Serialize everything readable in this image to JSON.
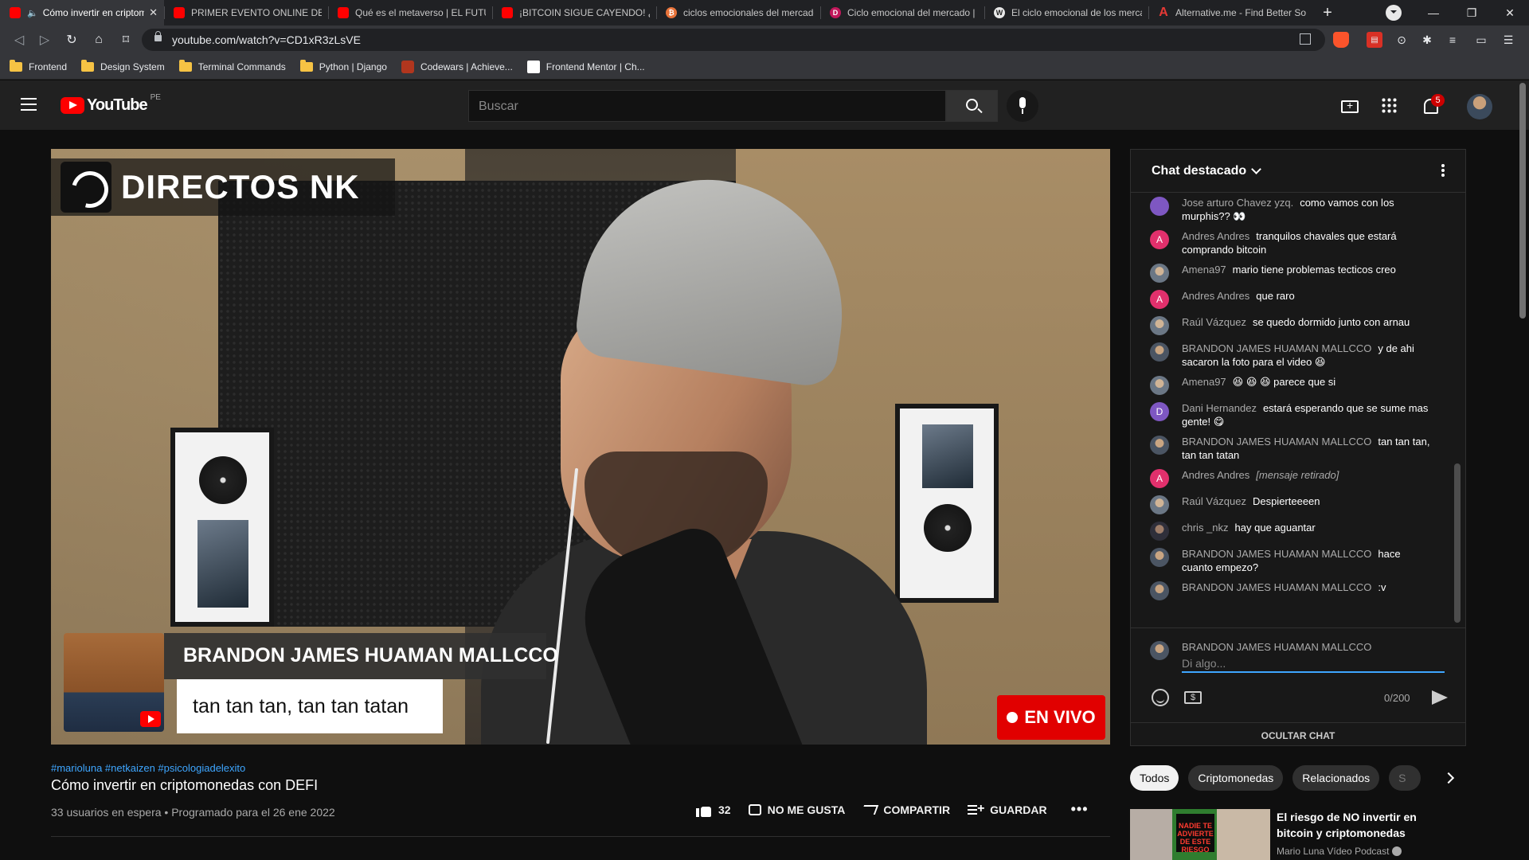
{
  "browser": {
    "tabs": [
      {
        "favicon": "youtube-favicon",
        "label": "Cómo invertir en criptomo",
        "active": true,
        "audio": true
      },
      {
        "favicon": "youtube-favicon",
        "label": "PRIMER EVENTO ONLINE DE COI",
        "active": false
      },
      {
        "favicon": "youtube-favicon",
        "label": "Qué es el metaverso | EL FUTURO",
        "active": false
      },
      {
        "favicon": "youtube-favicon",
        "label": "¡BITCOIN SIGUE CAYENDO! ¿Qué",
        "active": false
      },
      {
        "favicon": "bitcoin-favicon",
        "label": "ciclos emocionales del mercado",
        "active": false
      },
      {
        "favicon": "dp-favicon",
        "label": "Ciclo emocional del mercado | D",
        "active": false
      },
      {
        "favicon": "wikipedia-favicon",
        "label": "El ciclo emocional de los mercad",
        "active": false
      },
      {
        "favicon": "alternativeto-favicon",
        "label": "Alternative.me - Find Better Soft",
        "active": false
      }
    ],
    "url": "youtube.com/watch?v=CD1xR3zLsVE",
    "bookmarks": [
      {
        "type": "folder",
        "label": "Frontend"
      },
      {
        "type": "folder",
        "label": "Design System"
      },
      {
        "type": "folder",
        "label": "Terminal Commands"
      },
      {
        "type": "folder",
        "label": "Python | Django"
      },
      {
        "type": "site",
        "icon": "codewars-icon",
        "label": "Codewars | Achieve..."
      },
      {
        "type": "site",
        "icon": "frontendmentor-icon",
        "label": "Frontend Mentor | Ch..."
      }
    ]
  },
  "youtube": {
    "logo_text": "YouTube",
    "country_code": "PE",
    "search_placeholder": "Buscar",
    "notification_count": "5"
  },
  "video": {
    "overlay_brand": "DIRECTOS NK",
    "overlay_chat_name": "BRANDON JAMES HUAMAN MALLCCO",
    "overlay_chat_message": "tan tan tan, tan tan tatan",
    "live_label": "EN VIVO",
    "hashtags": "#marioluna #netkaizen #psicologiadelexito",
    "title": "Cómo invertir en criptomonedas con DEFI",
    "meta": "33 usuarios en espera • Programado para el 26 ene 2022",
    "actions": {
      "likes": "32",
      "dislike": "NO ME GUSTA",
      "share": "COMPARTIR",
      "save": "GUARDAR"
    }
  },
  "chat": {
    "header": "Chat destacado",
    "messages": [
      {
        "avatar": "purple",
        "initial": "",
        "author": "Jose arturo Chavez yzq.",
        "text": "como vamos con los murphis?? 👀",
        "retracted": false
      },
      {
        "avatar": "pink",
        "initial": "A",
        "author": "Andres Andres",
        "text": "tranquilos chavales que estará comprando bitcoin",
        "retracted": false
      },
      {
        "avatar": "photo2",
        "initial": "",
        "author": "Amena97",
        "text": "mario tiene problemas tecticos creo",
        "retracted": false
      },
      {
        "avatar": "pink",
        "initial": "A",
        "author": "Andres Andres",
        "text": "que raro",
        "retracted": false
      },
      {
        "avatar": "photo2",
        "initial": "",
        "author": "Raúl Vázquez",
        "text": "se quedo dormido junto con arnau",
        "retracted": false
      },
      {
        "avatar": "photo",
        "initial": "",
        "author": "BRANDON JAMES HUAMAN MALLCCO",
        "text": "y de ahi sacaron la foto para el video 😆",
        "retracted": false
      },
      {
        "avatar": "photo2",
        "initial": "",
        "author": "Amena97",
        "text": "😆 😆 😆 parece que si",
        "retracted": false
      },
      {
        "avatar": "purple",
        "initial": "D",
        "author": "Dani Hernandez",
        "text": "estará esperando que se sume mas gente! 😋",
        "retracted": false
      },
      {
        "avatar": "photo",
        "initial": "",
        "author": "BRANDON JAMES HUAMAN MALLCCO",
        "text": "tan tan tan, tan tan tatan",
        "retracted": false
      },
      {
        "avatar": "pink",
        "initial": "A",
        "author": "Andres Andres",
        "text": "[mensaje retirado]",
        "retracted": true
      },
      {
        "avatar": "photo2",
        "initial": "",
        "author": "Raúl Vázquez",
        "text": "Despierteeeen",
        "retracted": false
      },
      {
        "avatar": "dark",
        "initial": "",
        "author": "chris _nkz",
        "text": "hay que aguantar",
        "retracted": false
      },
      {
        "avatar": "photo",
        "initial": "",
        "author": "BRANDON JAMES HUAMAN MALLCCO",
        "text": "hace cuanto empezo?",
        "retracted": false
      },
      {
        "avatar": "photo",
        "initial": "",
        "author": "BRANDON JAMES HUAMAN MALLCCO",
        "text": ":v",
        "retracted": false
      }
    ],
    "input_user": "BRANDON JAMES HUAMAN MALLCCO",
    "input_placeholder": "Di algo...",
    "char_counter": "0/200",
    "hide_label": "OCULTAR CHAT"
  },
  "recommendations": {
    "chips": [
      "Todos",
      "Criptomonedas",
      "Relacionados",
      "S"
    ],
    "first": {
      "thumb_text": "NADIE TE ADVIERTE DE ESTE RIESGO",
      "title": "El riesgo de NO invertir en bitcoin y criptomonedas",
      "channel": "Mario Luna Vídeo Podcast"
    }
  },
  "colors": {
    "accent_blue": "#3ea6ff",
    "youtube_red": "#ff0000",
    "live_red": "#e10000",
    "background": "#0f0f0f"
  }
}
